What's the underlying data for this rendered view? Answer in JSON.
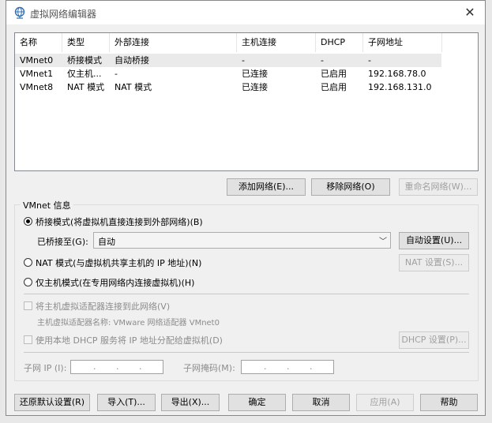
{
  "window": {
    "title": "虚拟网络编辑器",
    "close_label": "✕"
  },
  "table": {
    "headers": [
      "名称",
      "类型",
      "外部连接",
      "主机连接",
      "DHCP",
      "子网地址"
    ],
    "rows": [
      [
        "VMnet0",
        "桥接模式",
        "自动桥接",
        "-",
        "-",
        "-"
      ],
      [
        "VMnet1",
        "仅主机...",
        "-",
        "已连接",
        "已启用",
        "192.168.78.0"
      ],
      [
        "VMnet8",
        "NAT 模式",
        "NAT 模式",
        "已连接",
        "已启用",
        "192.168.131.0"
      ]
    ]
  },
  "network_buttons": {
    "add": "添加网络(E)...",
    "remove": "移除网络(O)",
    "rename": "重命名网络(W)..."
  },
  "vmnet_info": {
    "group_label": "VMnet 信息",
    "bridged_radio": "桥接模式(将虚拟机直接连接到外部网络)(B)",
    "bridged_to_label": "已桥接至(G):",
    "bridged_to_value": "自动",
    "auto_settings": "自动设置(U)...",
    "nat_radio": "NAT 模式(与虚拟机共享主机的 IP 地址)(N)",
    "nat_settings": "NAT 设置(S)...",
    "host_only_radio": "仅主机模式(在专用网络内连接虚拟机)(H)",
    "connect_adapter_check": "将主机虚拟适配器连接到此网络(V)",
    "adapter_name": "主机虚拟适配器名称: VMware 网络适配器 VMnet0",
    "dhcp_check": "使用本地 DHCP 服务将 IP 地址分配给虚拟机(D)",
    "dhcp_settings": "DHCP 设置(P)...",
    "subnet_ip_label": "子网 IP (I):",
    "subnet_mask_label": "子网掩码(M):",
    "ip_dot": "."
  },
  "bottom_buttons": {
    "restore": "还原默认设置(R)",
    "import": "导入(T)...",
    "export": "导出(X)...",
    "ok": "确定",
    "cancel": "取消",
    "apply": "应用(A)",
    "help": "帮助"
  }
}
